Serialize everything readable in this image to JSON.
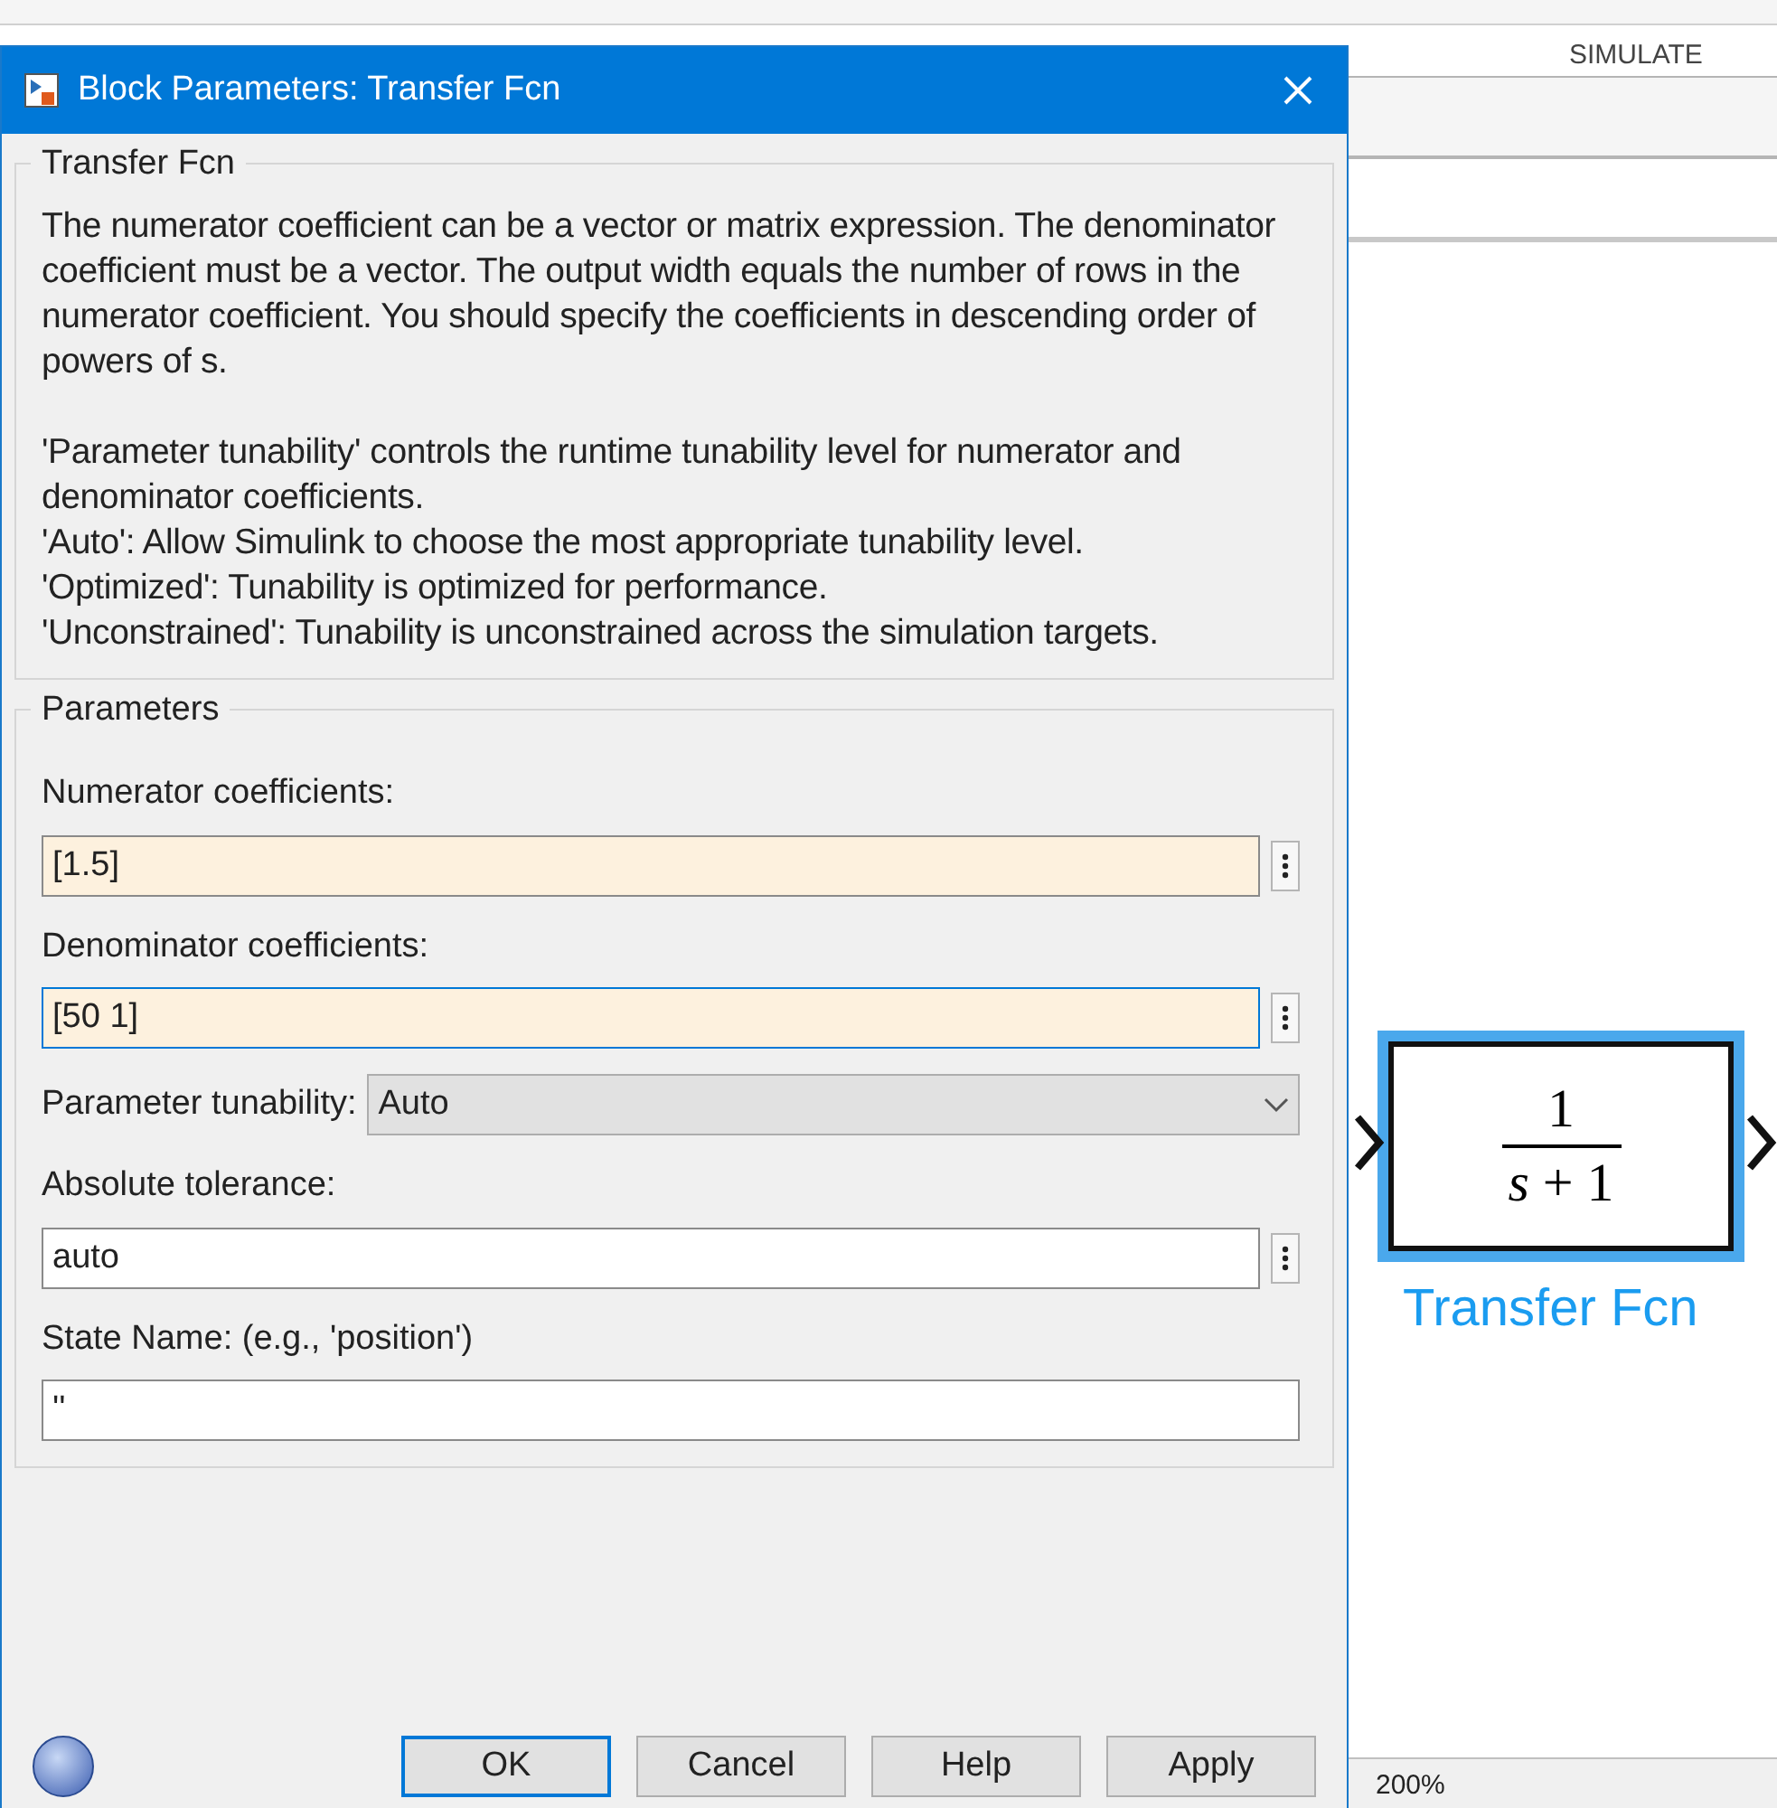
{
  "app": {
    "ribbon_tab": "SIMULATE",
    "zoom": "200%"
  },
  "block": {
    "numerator": "1",
    "denominator": "*s* + 1",
    "label": "Transfer Fcn",
    "selected": true
  },
  "dialog": {
    "title": "Block Parameters: Transfer Fcn",
    "description_group": "Transfer Fcn",
    "description": [
      "The numerator coefficient can be a vector or matrix expression. The denominator coefficient must be a vector. The output width equals the number of rows in the numerator coefficient. You should specify the coefficients in descending order of powers of s.",
      "'Parameter tunability' controls the runtime tunability level for numerator and denominator coefficients.",
      "'Auto': Allow Simulink to choose the most appropriate tunability level.",
      "'Optimized': Tunability is optimized for performance.",
      "'Unconstrained': Tunability is unconstrained across the simulation targets."
    ],
    "parameters_group": "Parameters",
    "fields": [
      {
        "kind": "text",
        "label": "Numerator coefficients:",
        "value": "[1.5]",
        "modified": true,
        "focused": false,
        "menu_button": true
      },
      {
        "kind": "text",
        "label": "Denominator coefficients:",
        "value": "[50 1]",
        "modified": true,
        "focused": true,
        "menu_button": true
      },
      {
        "kind": "dropdown",
        "label": "Parameter tunability:",
        "value": "Auto"
      },
      {
        "kind": "text",
        "label": "Absolute tolerance:",
        "value": "auto",
        "modified": false,
        "focused": false,
        "menu_button": true
      },
      {
        "kind": "text",
        "label": "State Name: (e.g., 'position')",
        "value": "''",
        "modified": false,
        "focused": false,
        "menu_button": false
      }
    ],
    "buttons": [
      {
        "label": "OK",
        "default": true
      },
      {
        "label": "Cancel",
        "default": false
      },
      {
        "label": "Help",
        "default": false
      },
      {
        "label": "Apply",
        "default": false
      }
    ]
  }
}
